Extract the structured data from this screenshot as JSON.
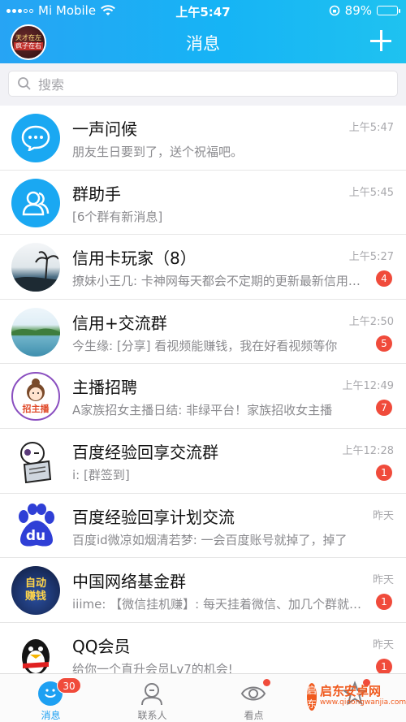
{
  "status_bar": {
    "carrier": "Mi Mobile",
    "time": "上午5:47",
    "battery": "89%",
    "battery_level": 0.89
  },
  "header": {
    "title": "消息",
    "avatar_text_top": "天才在左",
    "avatar_text_bottom": "疯子在右"
  },
  "search": {
    "placeholder": "搜索"
  },
  "conversations": [
    {
      "name": "一声问候",
      "preview": "朋友生日要到了，送个祝福吧。",
      "time": "上午5:47",
      "badge": "",
      "avatar": "chat-bubble-icon"
    },
    {
      "name": "群助手",
      "preview": "[6个群有新消息]",
      "time": "上午5:45",
      "badge": "",
      "avatar": "group-helper-icon"
    },
    {
      "name": "信用卡玩家（8）",
      "preview": "撩妹小王几: 卡神网每天都会不定期的更新最新信用卡资讯",
      "time": "上午5:27",
      "badge": "4",
      "avatar": "palm-landscape"
    },
    {
      "name": "信用+交流群",
      "preview": "今生缘: [分享] 看视频能赚钱，我在好看视频等你",
      "time": "上午2:50",
      "badge": "5",
      "avatar": "lake-landscape"
    },
    {
      "name": "主播招聘",
      "preview": "A家族招女主播日结: 非绿平台！家族招收女主播",
      "time": "上午12:49",
      "badge": "7",
      "avatar": "cartoon-girl",
      "avatar_text": "招主播"
    },
    {
      "name": "百度经验回享交流群",
      "preview": "i: [群签到]",
      "time": "上午12:28",
      "badge": "1",
      "avatar": "cartoon-reader"
    },
    {
      "name": "百度经验回享计划交流",
      "preview": "百度id微凉如烟清若梦: 一会百度账号就掉了，掉了",
      "time": "昨天",
      "badge": "",
      "avatar": "baidu-paw-logo",
      "avatar_text": "du"
    },
    {
      "name": "中国网络基金群",
      "preview": "iiime: 【微信挂机赚】: 每天挂着微信、加几个群就能赚钱",
      "time": "昨天",
      "badge": "1",
      "avatar": "auto-earn-logo",
      "avatar_text": "自动赚钱"
    },
    {
      "name": "QQ会员",
      "preview": "给你一个直升会员Lv7的机会!",
      "time": "昨天",
      "badge": "1",
      "avatar": "qq-penguin"
    }
  ],
  "tabbar": {
    "tabs": [
      {
        "label": "消息",
        "icon": "message-icon",
        "badge": "30"
      },
      {
        "label": "联系人",
        "icon": "contacts-icon",
        "badge": ""
      },
      {
        "label": "看点",
        "icon": "eye-icon",
        "badge": ""
      },
      {
        "label": "",
        "icon": "star-icon",
        "badge": ""
      }
    ]
  },
  "watermark": {
    "logo": "启东",
    "title": "启东安卓网",
    "url": "www.qidongwanjia.com"
  },
  "colors": {
    "header_start": "#27a4f4",
    "header_end": "#1fc2f0",
    "badge": "#f04b3b",
    "active_tab": "#1ea0f2"
  }
}
